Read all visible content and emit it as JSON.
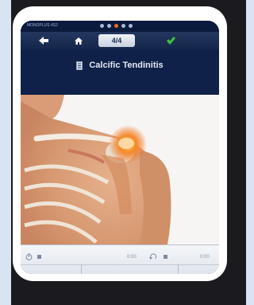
{
  "status_bar": {
    "left_text": "MONOPLUS 4S2",
    "page_dots": 5,
    "active_dot": 2
  },
  "toolbar": {
    "page_indicator": "4/4",
    "icons": [
      "arrow-left-icon",
      "home-icon",
      "checkmark-icon"
    ],
    "check_color": "#3fc23a"
  },
  "title": {
    "text": "Calcific Tendinitis",
    "icon": "document-icon"
  },
  "image": {
    "subject": "shoulder anatomy illustration",
    "highlight_color": "#f26a1d"
  },
  "player": {
    "left_time": "0:00",
    "right_time": "0:00",
    "icons": [
      "stopwatch-icon",
      "replay-icon"
    ]
  }
}
